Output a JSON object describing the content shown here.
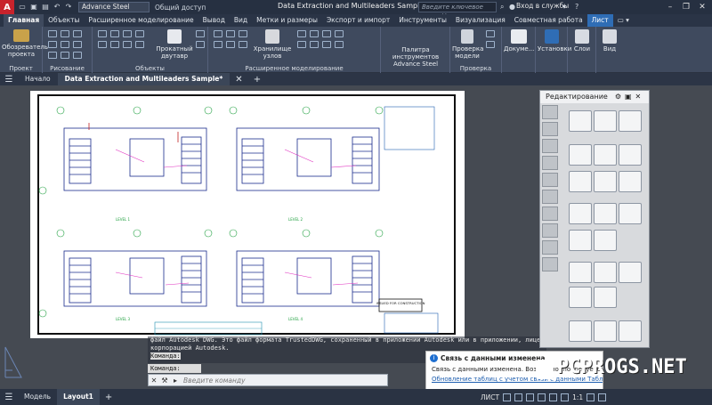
{
  "title_bar": {
    "logo_letter": "A",
    "workspace": "Advance Steel",
    "share": "Общий доступ",
    "document_title": "Data Extraction and Multileaders Sample.dwg",
    "search_placeholder": "Введите ключевое слово/фразу",
    "sign_in": "Вход в службы"
  },
  "ribbon_tabs": [
    "Главная",
    "Объекты",
    "Расширенное моделирование",
    "Вывод",
    "Вид",
    "Метки и размеры",
    "Экспорт и импорт",
    "Инструменты",
    "Визуализация",
    "Совместная работа",
    "Лист"
  ],
  "ribbon": {
    "project_button": "Обозреватель проекта",
    "project_group": "Проект",
    "draw_group": "Рисование",
    "beam_button": "Прокатный двутавр",
    "objects_group": "Объекты",
    "storage_button": "Хранилище узлов",
    "advanced_group": "Расширенное моделирование",
    "palette_button": "Палитра инструментов Advance Steel",
    "check_button": "Проверка модели",
    "check_group": "Проверка",
    "docs_button": "Докуме...",
    "settings_button": "Установки",
    "layers_button": "Слои",
    "view_button": "Вид"
  },
  "file_tabs": {
    "home": "Начало",
    "active": "Data Extraction and Multileaders Sample*"
  },
  "drawing": {
    "levels": [
      "LEVEL 1",
      "LEVEL 2",
      "LEVEL 3",
      "LEVEL 4"
    ],
    "stamp": "ISSUED FOR CONSTRUCTION"
  },
  "command": {
    "history_line1": "файл Autodesk DWG. Это файл формата TrustedDWG, сохраненный в приложении Autodesk или в приложении, лицензированном",
    "history_line2": "корпорацией Autodesk.",
    "history_line3": "Команда:",
    "history_line4": "Команда:",
    "placeholder": "Введите команду"
  },
  "notification": {
    "title": "Связь с данными изменена",
    "body": "Связь с данными изменена. Возможно, потребуется",
    "link": "Обновление таблиц с учетом связи с данными Таблица"
  },
  "palette": {
    "title": "Редактирование"
  },
  "status": {
    "model_tab": "Модель",
    "layout_tab": "Layout1",
    "sheet_label": "ЛИСТ",
    "scale": "1:1"
  },
  "watermark": "PCPROGS.NET",
  "colors": {
    "accent": "#2f6db5",
    "logo": "#c8232c"
  }
}
